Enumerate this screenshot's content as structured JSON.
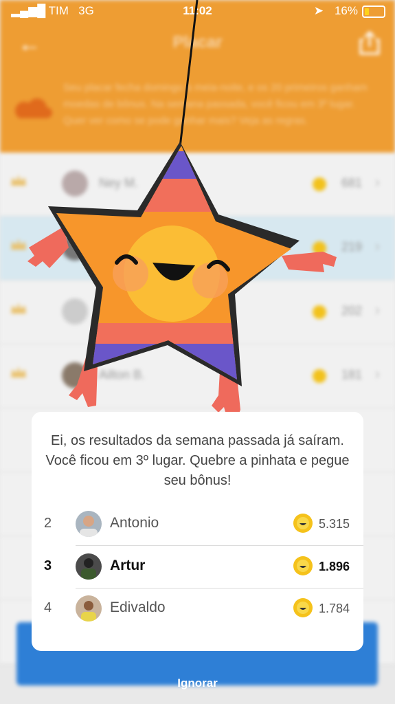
{
  "status_bar": {
    "carrier": "TIM",
    "network": "3G",
    "time": "11:02",
    "battery": "16%"
  },
  "header": {
    "title": "Placar",
    "info": "Seu placar fecha domingo à meia-noite, e os 20 primeiros ganham moedas de bônus. Na semana passada, você ficou em 3º lugar. Quer ver como se pode ganhar mais? Veja as regras."
  },
  "background_rows": [
    {
      "name": "Ney M.",
      "points": "681"
    },
    {
      "name": "",
      "points": "219"
    },
    {
      "name": "",
      "points": "202"
    },
    {
      "name": "Ailton B.",
      "points": "181"
    }
  ],
  "modal": {
    "message": "Ei, os resultados da semana passada já saíram. Você ficou em 3º lugar. Quebre a pinhata e pegue seu bônus!",
    "rows": [
      {
        "position": "2",
        "name": "Antonio",
        "points": "5.315"
      },
      {
        "position": "3",
        "name": "Artur",
        "points": "1.896"
      },
      {
        "position": "4",
        "name": "Edivaldo",
        "points": "1.784"
      }
    ]
  },
  "ignore_label": "Ignorar",
  "colors": {
    "header": "#ee9d33",
    "star": "#f7962b",
    "coin": "#f5c21b",
    "accent_blue": "#2e7fd6"
  }
}
